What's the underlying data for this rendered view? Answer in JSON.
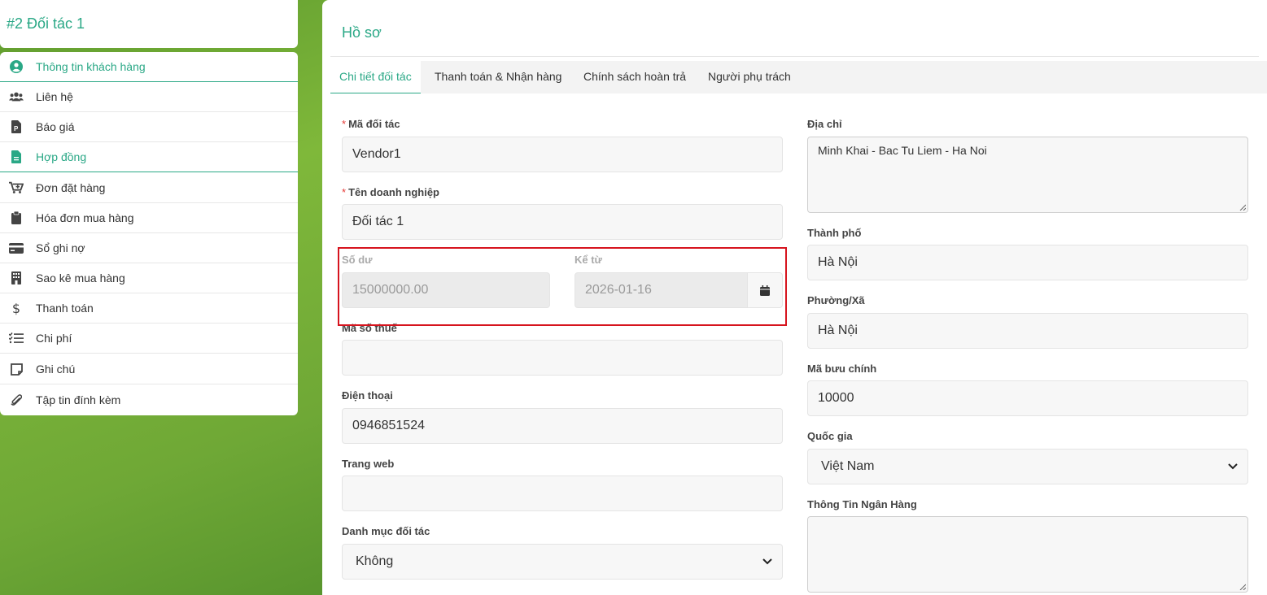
{
  "sidebar": {
    "title": "#2 Đối tác 1",
    "items": [
      {
        "label": "Thông tin khách hàng",
        "icon": "user-circle-icon"
      },
      {
        "label": "Liên hệ",
        "icon": "users-icon"
      },
      {
        "label": "Báo giá",
        "icon": "file-p-icon"
      },
      {
        "label": "Hợp đồng",
        "icon": "file-text-icon"
      },
      {
        "label": "Đơn đặt hàng",
        "icon": "cart-plus-icon"
      },
      {
        "label": "Hóa đơn mua hàng",
        "icon": "clipboard-icon"
      },
      {
        "label": "Sổ ghi nợ",
        "icon": "credit-card-icon"
      },
      {
        "label": "Sao kê mua hàng",
        "icon": "building-icon"
      },
      {
        "label": "Thanh toán",
        "icon": "dollar-icon"
      },
      {
        "label": "Chi phí",
        "icon": "list-check-icon"
      },
      {
        "label": "Ghi chú",
        "icon": "sticky-note-icon"
      },
      {
        "label": "Tập tin đính kèm",
        "icon": "paperclip-icon"
      }
    ]
  },
  "main": {
    "heading": "Hồ sơ",
    "tabs": [
      "Chi tiết đối tác",
      "Thanh toán & Nhận hàng",
      "Chính sách hoàn trả",
      "Người phụ trách"
    ]
  },
  "form": {
    "vendor_code": {
      "label": "Mã đối tác",
      "value": "Vendor1"
    },
    "company_name": {
      "label": "Tên doanh nghiệp",
      "value": "Đối tác 1"
    },
    "balance": {
      "label": "Số dư",
      "value": "15000000.00"
    },
    "since": {
      "label": "Kể từ",
      "value": "2026-01-16"
    },
    "tax_code": {
      "label": "Mã số thuế",
      "value": ""
    },
    "phone": {
      "label": "Điện thoại",
      "value": "0946851524"
    },
    "website": {
      "label": "Trang web",
      "value": ""
    },
    "category": {
      "label": "Danh mục đối tác",
      "value": "Không"
    },
    "address": {
      "label": "Địa chỉ",
      "value": "Minh Khai - Bac Tu Liem - Ha Noi"
    },
    "city": {
      "label": "Thành phố",
      "value": "Hà Nội"
    },
    "ward": {
      "label": "Phường/Xã",
      "value": "Hà Nội"
    },
    "postal": {
      "label": "Mã bưu chính",
      "value": "10000"
    },
    "country": {
      "label": "Quốc gia",
      "value": "Việt Nam"
    },
    "bank": {
      "label": "Thông Tin Ngân Hàng",
      "value": ""
    }
  },
  "colors": {
    "accent": "#2aa886",
    "highlight": "#d6141e"
  }
}
